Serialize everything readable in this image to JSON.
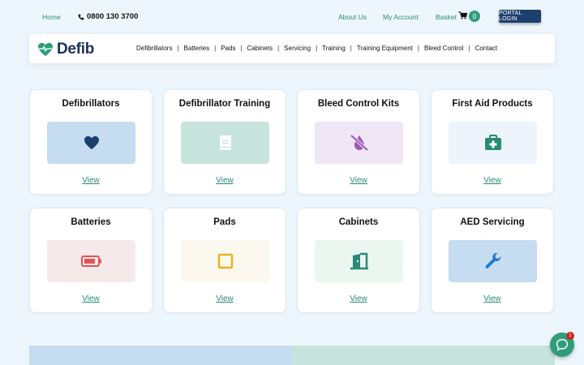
{
  "topbar": {
    "home": "Home",
    "phone": "0800 130 3700",
    "about": "About Us",
    "account": "My Account",
    "basket": "Basket",
    "basket_count": "0",
    "portal": "PORTAL LOGIN"
  },
  "brand": {
    "name": "Defib",
    "icon": "heart-pulse-icon"
  },
  "nav": {
    "items": [
      "Defibrillators",
      "Batteries",
      "Pads",
      "Cabinets",
      "Servicing",
      "Training",
      "Training Equipment",
      "Bleed Control",
      "Contact"
    ],
    "separator": "|"
  },
  "cards": [
    {
      "title": "Defibrillators",
      "link": "View",
      "icon": "heart-icon",
      "tile_color": "#c5dcf1",
      "icon_color": "#1d3f6e"
    },
    {
      "title": "Defibrillator Training",
      "link": "View",
      "icon": "book-icon",
      "tile_color": "#c6e3dc",
      "icon_color": "#ffffff"
    },
    {
      "title": "Bleed Control Kits",
      "link": "View",
      "icon": "no-bleed-icon",
      "tile_color": "#efe6f5",
      "icon_color": "#9b59b6"
    },
    {
      "title": "First Aid Products",
      "link": "View",
      "icon": "first-aid-kit-icon",
      "tile_color": "#edf4fb",
      "icon_color": "#2a8a78"
    },
    {
      "title": "Batteries",
      "link": "View",
      "icon": "battery-icon",
      "tile_color": "#f6e9e9",
      "icon_color": "#e05555"
    },
    {
      "title": "Pads",
      "link": "View",
      "icon": "square-icon",
      "tile_color": "#fbf8ef",
      "icon_color": "#e6b422"
    },
    {
      "title": "Cabinets",
      "link": "View",
      "icon": "door-open-icon",
      "tile_color": "#eaf6ef",
      "icon_color": "#2a8a78"
    },
    {
      "title": "AED Servicing",
      "link": "View",
      "icon": "wrench-icon",
      "tile_color": "#c5dcf1",
      "icon_color": "#1e7ad0"
    }
  ],
  "chat": {
    "badge": "1",
    "icon": "chat-bubble-icon"
  }
}
